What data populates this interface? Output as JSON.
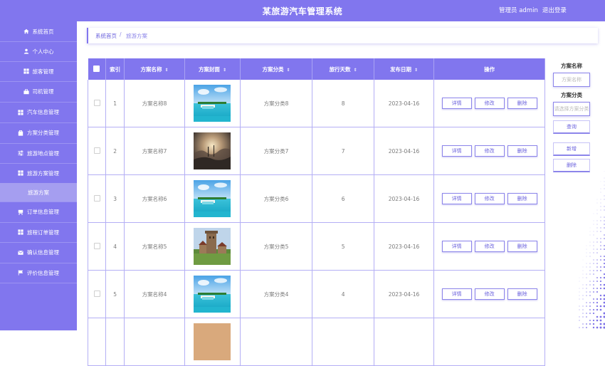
{
  "header": {
    "title": "某旅游汽车管理系统",
    "user": "管理员 admin",
    "logout": "退出登录"
  },
  "sidebar": {
    "items": [
      {
        "label": "系统首页",
        "icon": "home-icon"
      },
      {
        "label": "个人中心",
        "icon": "user-icon"
      },
      {
        "label": "旅客管理",
        "icon": "grid-icon"
      },
      {
        "label": "司机管理",
        "icon": "briefcase-icon"
      },
      {
        "label": "汽车信息管理",
        "icon": "grid-icon"
      },
      {
        "label": "方案分类管理",
        "icon": "bag-icon"
      },
      {
        "label": "旅游地点管理",
        "icon": "sliders-icon"
      },
      {
        "label": "旅游方案管理",
        "icon": "grid-icon"
      },
      {
        "label": "旅游方案",
        "icon": ""
      },
      {
        "label": "订单信息管理",
        "icon": "cart-icon"
      },
      {
        "label": "旅程订单管理",
        "icon": "grid-icon"
      },
      {
        "label": "确认信息管理",
        "icon": "mail-icon"
      },
      {
        "label": "评价信息管理",
        "icon": "flag-icon"
      }
    ]
  },
  "breadcrumb": {
    "home": "系统首页",
    "separator": "/",
    "current": "旅游方案"
  },
  "table": {
    "headers": [
      "索引",
      "方案名称",
      "方案封面",
      "方案分类",
      "旅行天数",
      "发布日期",
      "操作"
    ],
    "actions": {
      "detail": "详情",
      "edit": "修改",
      "delete": "删除"
    },
    "rows": [
      {
        "index": "1",
        "name": "方案名称8",
        "cover": "beach",
        "category": "方案分类8",
        "days": "8",
        "date": "2023-04-16"
      },
      {
        "index": "2",
        "name": "方案名称7",
        "cover": "misty",
        "category": "方案分类7",
        "days": "7",
        "date": "2023-04-16"
      },
      {
        "index": "3",
        "name": "方案名称6",
        "cover": "beach",
        "category": "方案分类6",
        "days": "6",
        "date": "2023-04-16"
      },
      {
        "index": "4",
        "name": "方案名称5",
        "cover": "castle",
        "category": "方案分类5",
        "days": "5",
        "date": "2023-04-16"
      },
      {
        "index": "5",
        "name": "方案名称4",
        "cover": "beach",
        "category": "方案分类4",
        "days": "4",
        "date": "2023-04-16"
      }
    ]
  },
  "search": {
    "name_label": "方案名称",
    "name_placeholder": "方案名称",
    "category_label": "方案分类",
    "category_placeholder": "请选择方案分类",
    "search_button": "查询",
    "add_button": "新增",
    "delete_button": "删除"
  },
  "colors": {
    "primary": "#8176ee",
    "active": "#a59ef0"
  }
}
